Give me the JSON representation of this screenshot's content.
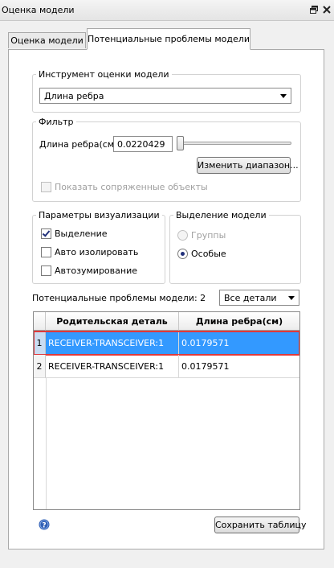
{
  "window": {
    "title": "Оценка модели"
  },
  "tabs": [
    {
      "label": "Оценка модели",
      "active": false
    },
    {
      "label": "Потенциальные проблемы модели",
      "active": true
    }
  ],
  "tool_group": {
    "label": "Инструмент оценки модели",
    "selected": "Длина ребра"
  },
  "filter_group": {
    "label": "Фильтр",
    "edge_length_label": "Длина ребра(см)",
    "edge_length_value": "0.0220429",
    "slider_fraction": 0.0,
    "change_range_button": "Изменить диапазон...",
    "show_related_label": "Показать сопряженные объекты",
    "show_related_checked": false
  },
  "visual_group": {
    "label": "Параметры визуализации",
    "items": [
      {
        "label": "Выделение",
        "checked": true
      },
      {
        "label": "Авто изолировать",
        "checked": false
      },
      {
        "label": "Автозумирование",
        "checked": false
      }
    ]
  },
  "selection_group": {
    "label": "Выделение модели",
    "options": [
      {
        "label": "Группы",
        "selected": false,
        "disabled": true
      },
      {
        "label": "Особые",
        "selected": true,
        "disabled": false
      }
    ]
  },
  "issues": {
    "label": "Потенциальные проблемы модели: 2",
    "filter_selected": "Все детали"
  },
  "table": {
    "columns": [
      "Родительская деталь",
      "Длина ребра(см)"
    ],
    "rows": [
      {
        "num": "1",
        "part": "RECEIVER-TRANSCEIVER:1",
        "length": "0.0179571",
        "selected": true
      },
      {
        "num": "2",
        "part": "RECEIVER-TRANSCEIVER:1",
        "length": "0.0179571",
        "selected": false
      }
    ]
  },
  "footer": {
    "save_button": "Сохранить таблицу",
    "help_icon": "question-circle-icon"
  },
  "colors": {
    "selection": "#3399ff",
    "highlight_outline": "#e0393b",
    "help_icon": "#2f5fb5"
  }
}
